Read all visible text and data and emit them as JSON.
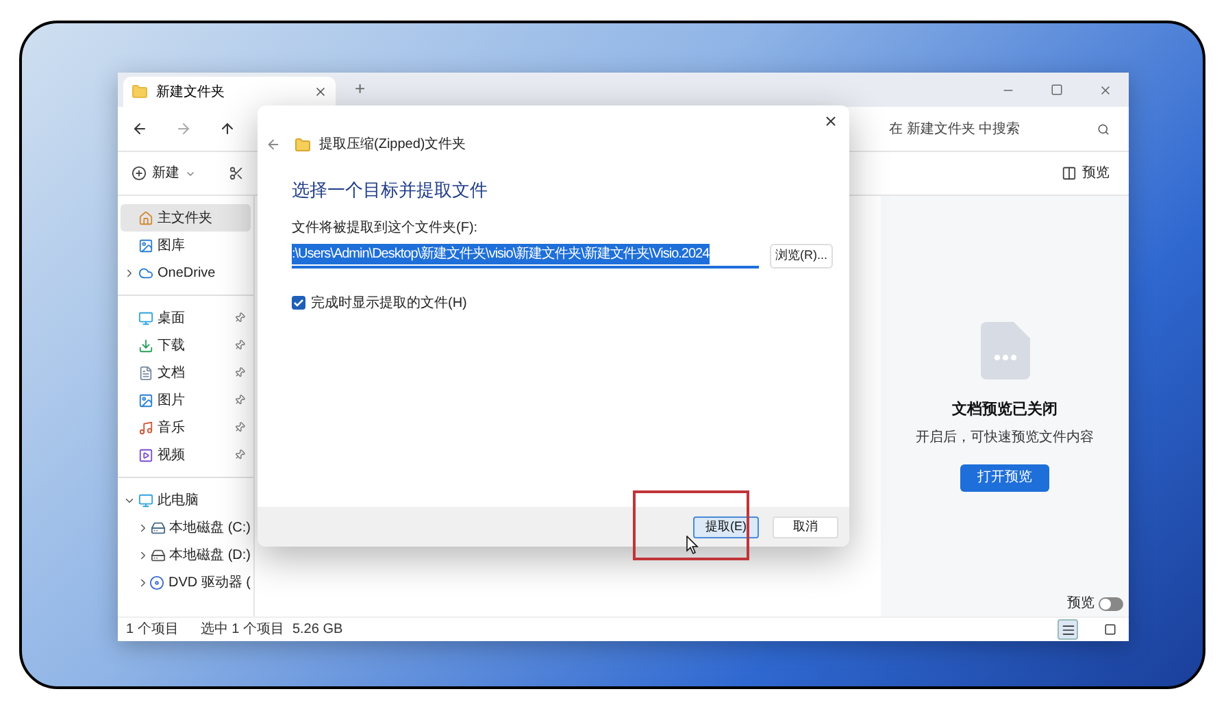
{
  "explorer": {
    "tab": {
      "title": "新建文件夹",
      "selected": true
    },
    "new_tab": "+",
    "search": {
      "placeholder": "在 新建文件夹 中搜索"
    },
    "commands": {
      "new": "新建",
      "preview": "预览"
    },
    "sidebar": [
      [
        {
          "label": "主文件夹",
          "kind": "home",
          "selected": true,
          "pinned": false
        },
        {
          "label": "图库",
          "kind": "gallery",
          "selected": false,
          "pinned": false
        },
        {
          "label": "OneDrive",
          "kind": "cloud",
          "selected": false,
          "pinned": false,
          "expanded": false
        }
      ],
      [
        {
          "label": "桌面",
          "kind": "desktop",
          "selected": false,
          "pinned": true
        },
        {
          "label": "下载",
          "kind": "download",
          "selected": false,
          "pinned": true
        },
        {
          "label": "文档",
          "kind": "document",
          "selected": false,
          "pinned": true
        },
        {
          "label": "图片",
          "kind": "pictures",
          "selected": false,
          "pinned": true
        },
        {
          "label": "音乐",
          "kind": "music",
          "selected": false,
          "pinned": true
        },
        {
          "label": "视频",
          "kind": "video",
          "selected": false,
          "pinned": true
        }
      ],
      [
        {
          "label": "此电脑",
          "kind": "pc",
          "selected": false,
          "pinned": false,
          "expanded": true,
          "children": [
            {
              "label": "本地磁盘 (C:)",
              "kind": "system-drive",
              "selected": false,
              "pinned": false,
              "expanded": false
            },
            {
              "label": "本地磁盘 (D:)",
              "kind": "drive",
              "selected": false,
              "pinned": false,
              "expanded": false
            },
            {
              "label": "DVD 驱动器 (",
              "kind": "dvd",
              "selected": false,
              "pinned": false,
              "expanded": false
            }
          ]
        }
      ]
    ],
    "preview_pane": {
      "title": "文档预览已关闭",
      "subtitle": "开启后，可快速预览文件内容",
      "button": "打开预览",
      "toggle_label": "预览",
      "toggle_on": false
    },
    "status_bar": {
      "count": "1 个项目",
      "selection": "选中 1 个项目",
      "size": "5.26 GB"
    },
    "views": [
      {
        "kind": "details",
        "selected": true
      },
      {
        "kind": "tiles",
        "selected": false
      }
    ]
  },
  "dialog": {
    "title": "提取压缩(Zipped)文件夹",
    "heading": "选择一个目标并提取文件",
    "field_label": "文件将被提取到这个文件夹(F):",
    "path": ":\\Users\\Admin\\Desktop\\新建文件夹\\visio\\新建文件夹\\新建文件夹\\Visio.2024",
    "browse": "浏览(R)...",
    "checkbox": {
      "label": "完成时显示提取的文件(H)",
      "checked": true
    },
    "buttons": [
      {
        "label": "提取(E)",
        "primary": true
      },
      {
        "label": "取消",
        "primary": false
      }
    ]
  }
}
